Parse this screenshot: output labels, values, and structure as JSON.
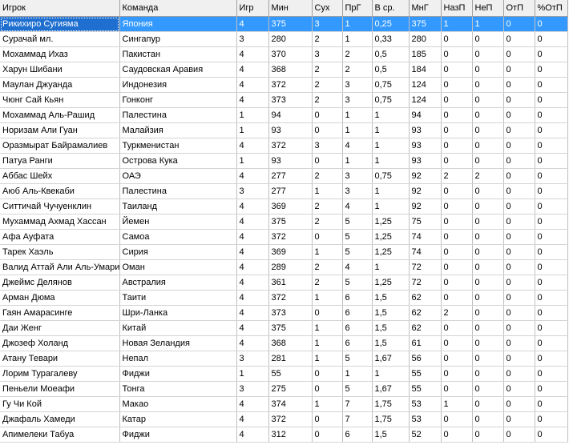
{
  "columns": [
    "Игрок",
    "Команда",
    "Игр",
    "Мин",
    "Сух",
    "ПрГ",
    "В ср.",
    "МнГ",
    "НазП",
    "НеП",
    "ОтП",
    "%ОтП"
  ],
  "selected_row": 0,
  "rows": [
    [
      "Рикихиро Сугияма",
      "Япония",
      "4",
      "375",
      "3",
      "1",
      "0,25",
      "375",
      "1",
      "1",
      "0",
      "0"
    ],
    [
      "Сурачай мл.",
      "Сингапур",
      "3",
      "280",
      "2",
      "1",
      "0,33",
      "280",
      "0",
      "0",
      "0",
      "0"
    ],
    [
      "Мохаммад Ихаз",
      "Пакистан",
      "4",
      "370",
      "3",
      "2",
      "0,5",
      "185",
      "0",
      "0",
      "0",
      "0"
    ],
    [
      "Харун Шибани",
      "Саудовская Аравия",
      "4",
      "368",
      "2",
      "2",
      "0,5",
      "184",
      "0",
      "0",
      "0",
      "0"
    ],
    [
      "Маулан Джуанда",
      "Индонезия",
      "4",
      "372",
      "2",
      "3",
      "0,75",
      "124",
      "0",
      "0",
      "0",
      "0"
    ],
    [
      "Чюнг Сай Кьян",
      "Гонконг",
      "4",
      "373",
      "2",
      "3",
      "0,75",
      "124",
      "0",
      "0",
      "0",
      "0"
    ],
    [
      "Мохаммад Аль-Рашид",
      "Палестина",
      "1",
      "94",
      "0",
      "1",
      "1",
      "94",
      "0",
      "0",
      "0",
      "0"
    ],
    [
      "Норизам Али Гуан",
      "Малайзия",
      "1",
      "93",
      "0",
      "1",
      "1",
      "93",
      "0",
      "0",
      "0",
      "0"
    ],
    [
      "Оразмырат Байрамалиев",
      "Туркменистан",
      "4",
      "372",
      "3",
      "4",
      "1",
      "93",
      "0",
      "0",
      "0",
      "0"
    ],
    [
      "Патуа Ранги",
      "Острова Кука",
      "1",
      "93",
      "0",
      "1",
      "1",
      "93",
      "0",
      "0",
      "0",
      "0"
    ],
    [
      "Аббас Шейх",
      "ОАЭ",
      "4",
      "277",
      "2",
      "3",
      "0,75",
      "92",
      "2",
      "2",
      "0",
      "0"
    ],
    [
      "Аюб Аль-Квекаби",
      "Палестина",
      "3",
      "277",
      "1",
      "3",
      "1",
      "92",
      "0",
      "0",
      "0",
      "0"
    ],
    [
      "Ситтичай Чучуенклин",
      "Таиланд",
      "4",
      "369",
      "2",
      "4",
      "1",
      "92",
      "0",
      "0",
      "0",
      "0"
    ],
    [
      "Мухаммад Ахмад Хассан",
      "Йемен",
      "4",
      "375",
      "2",
      "5",
      "1,25",
      "75",
      "0",
      "0",
      "0",
      "0"
    ],
    [
      "Афа Ауфата",
      "Самоа",
      "4",
      "372",
      "0",
      "5",
      "1,25",
      "74",
      "0",
      "0",
      "0",
      "0"
    ],
    [
      "Тарек Хаэль",
      "Сирия",
      "4",
      "369",
      "1",
      "5",
      "1,25",
      "74",
      "0",
      "0",
      "0",
      "0"
    ],
    [
      "Валид Аттай Али Аль-Умари",
      "Оман",
      "4",
      "289",
      "2",
      "4",
      "1",
      "72",
      "0",
      "0",
      "0",
      "0"
    ],
    [
      "Джеймс Делянов",
      "Австралия",
      "4",
      "361",
      "2",
      "5",
      "1,25",
      "72",
      "0",
      "0",
      "0",
      "0"
    ],
    [
      "Арман Дюма",
      "Таити",
      "4",
      "372",
      "1",
      "6",
      "1,5",
      "62",
      "0",
      "0",
      "0",
      "0"
    ],
    [
      "Гаян Амарасинге",
      "Шри-Ланка",
      "4",
      "373",
      "0",
      "6",
      "1,5",
      "62",
      "2",
      "0",
      "0",
      "0"
    ],
    [
      "Даи Женг",
      "Китай",
      "4",
      "375",
      "1",
      "6",
      "1,5",
      "62",
      "0",
      "0",
      "0",
      "0"
    ],
    [
      "Джозеф Холанд",
      "Новая Зеландия",
      "4",
      "368",
      "1",
      "6",
      "1,5",
      "61",
      "0",
      "0",
      "0",
      "0"
    ],
    [
      "Атану Тевари",
      "Непал",
      "3",
      "281",
      "1",
      "5",
      "1,67",
      "56",
      "0",
      "0",
      "0",
      "0"
    ],
    [
      "Лорим Турагалеву",
      "Фиджи",
      "1",
      "55",
      "0",
      "1",
      "1",
      "55",
      "0",
      "0",
      "0",
      "0"
    ],
    [
      "Пеньели Моеафи",
      "Тонга",
      "3",
      "275",
      "0",
      "5",
      "1,67",
      "55",
      "0",
      "0",
      "0",
      "0"
    ],
    [
      "Гу Чи Кой",
      "Макао",
      "4",
      "374",
      "1",
      "7",
      "1,75",
      "53",
      "1",
      "0",
      "0",
      "0"
    ],
    [
      "Джафаль Хамеди",
      "Катар",
      "4",
      "372",
      "0",
      "7",
      "1,75",
      "53",
      "0",
      "0",
      "0",
      "0"
    ],
    [
      "Апимелеки Табуа",
      "Фиджи",
      "4",
      "312",
      "0",
      "6",
      "1,5",
      "52",
      "0",
      "0",
      "0",
      "0"
    ]
  ]
}
